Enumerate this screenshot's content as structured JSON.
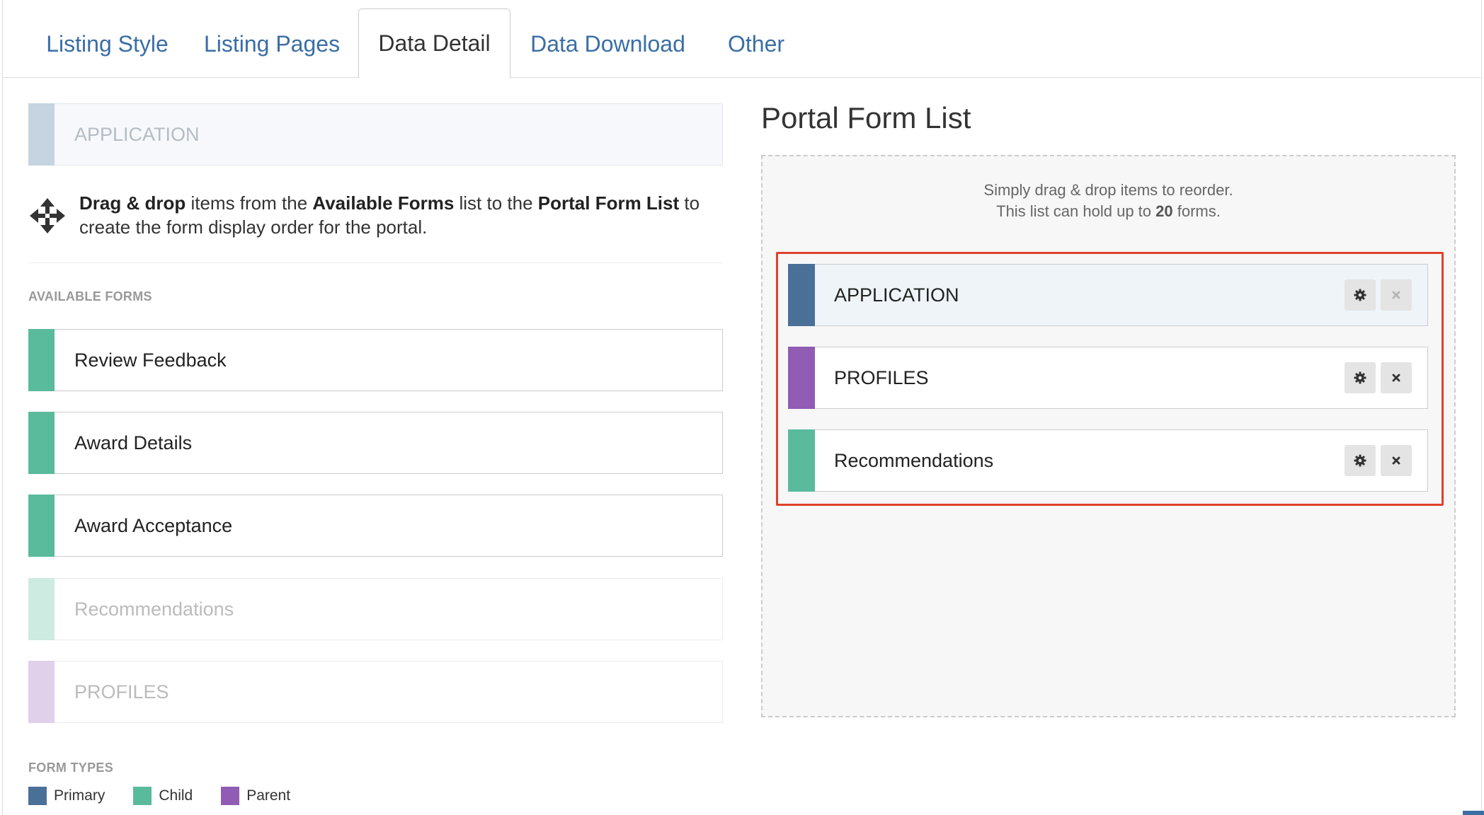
{
  "tabs": [
    {
      "label": "Listing Style",
      "active": false
    },
    {
      "label": "Listing Pages",
      "active": false
    },
    {
      "label": "Data Detail",
      "active": true
    },
    {
      "label": "Data Download",
      "active": false
    },
    {
      "label": "Other",
      "active": false
    }
  ],
  "colors": {
    "primary": "#4a7098",
    "child": "#5aba9c",
    "parent": "#915cb4",
    "primary_faded": "#c6d3e0",
    "child_faded": "#cdebe0",
    "parent_faded": "#e1d0ea",
    "highlight": "#e0402b",
    "tab_link": "#3a6ea5"
  },
  "pinned_form": {
    "label": "APPLICATION"
  },
  "instructions": {
    "icon": "move-arrows-icon",
    "bold1": "Drag & drop",
    "text1": " items from the ",
    "bold2": "Available Forms",
    "text2": " list to the ",
    "bold3": "Portal Form List",
    "text3": " to create the form display order for the portal."
  },
  "available_forms": {
    "title": "AVAILABLE FORMS",
    "items": [
      {
        "label": "Review Feedback",
        "type": "child",
        "used": false
      },
      {
        "label": "Award Details",
        "type": "child",
        "used": false
      },
      {
        "label": "Award Acceptance",
        "type": "child",
        "used": false
      },
      {
        "label": "Recommendations",
        "type": "child",
        "used": true
      },
      {
        "label": "PROFILES",
        "type": "parent",
        "used": true
      }
    ]
  },
  "form_types": {
    "title": "FORM TYPES",
    "items": [
      {
        "label": "Primary",
        "color": "#4a7098"
      },
      {
        "label": "Child",
        "color": "#5aba9c"
      },
      {
        "label": "Parent",
        "color": "#915cb4"
      }
    ]
  },
  "portal_form_list": {
    "title": "Portal Form List",
    "hint_line1": "Simply drag & drop items to reorder.",
    "hint_line2_pre": "This list can hold up to ",
    "hint_line2_bold": "20",
    "hint_line2_post": " forms.",
    "items": [
      {
        "label": "APPLICATION",
        "type": "primary",
        "removable": false
      },
      {
        "label": "PROFILES",
        "type": "parent",
        "removable": true
      },
      {
        "label": "Recommendations",
        "type": "child",
        "removable": true
      }
    ]
  }
}
